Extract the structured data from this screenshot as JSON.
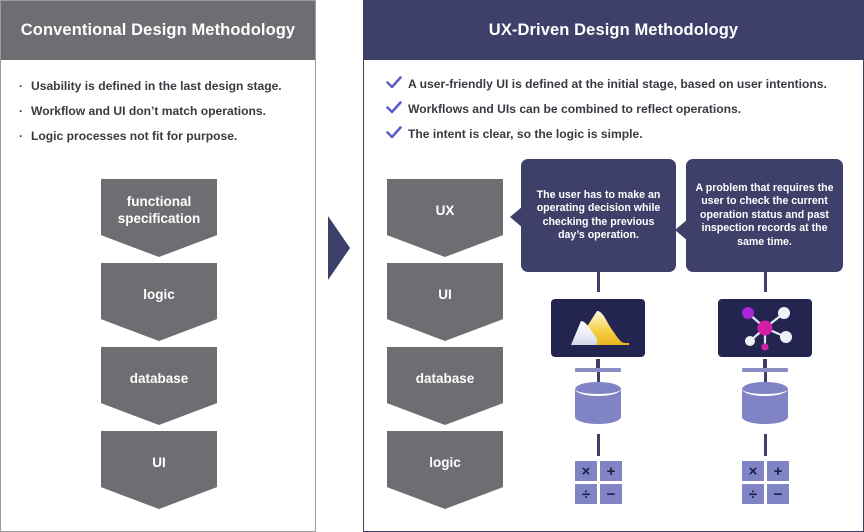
{
  "left_panel": {
    "title": "Conventional Design Methodology",
    "header_color": "#6e6e72",
    "bullets": [
      {
        "marker": "·",
        "text": "Usability is defined in the last design stage."
      },
      {
        "marker": "·",
        "text": "Workflow and UI don’t match operations."
      },
      {
        "marker": "·",
        "text": "Logic processes not fit for purpose."
      }
    ],
    "flow_steps": [
      {
        "label": "functional specification"
      },
      {
        "label": "logic"
      },
      {
        "label": "database"
      },
      {
        "label": "UI"
      }
    ]
  },
  "right_panel": {
    "title": "UX-Driven Design Methodology",
    "header_color": "#3e4069",
    "check_color": "#5b60c4",
    "bullets": [
      {
        "marker": "check",
        "text": "A user-friendly UI is defined at the initial stage, based on user intentions."
      },
      {
        "marker": "check",
        "text": "Workflows and UIs can be combined to reflect operations."
      },
      {
        "marker": "check",
        "text": "The intent is clear, so the logic is simple."
      }
    ],
    "flow_steps": [
      {
        "label": "UX"
      },
      {
        "label": "UI"
      },
      {
        "label": "database"
      },
      {
        "label": "logic"
      }
    ],
    "callouts": [
      {
        "text": "The user has to make an operating decision while checking the previous day’s operation."
      },
      {
        "text": "A problem that requires the user to check the current operation status and past inspection records at the same time."
      }
    ],
    "icon_columns": [
      {
        "monitor": "area-chart-monitor-icon",
        "database": "database-cylinder-icon",
        "operators": [
          "×",
          "+",
          "÷",
          "−"
        ]
      },
      {
        "monitor": "network-graph-monitor-icon",
        "database": "database-cylinder-icon",
        "operators": [
          "×",
          "+",
          "÷",
          "−"
        ]
      }
    ]
  },
  "transition_arrow": {
    "name": "right-arrow",
    "color": "#3e4069"
  }
}
